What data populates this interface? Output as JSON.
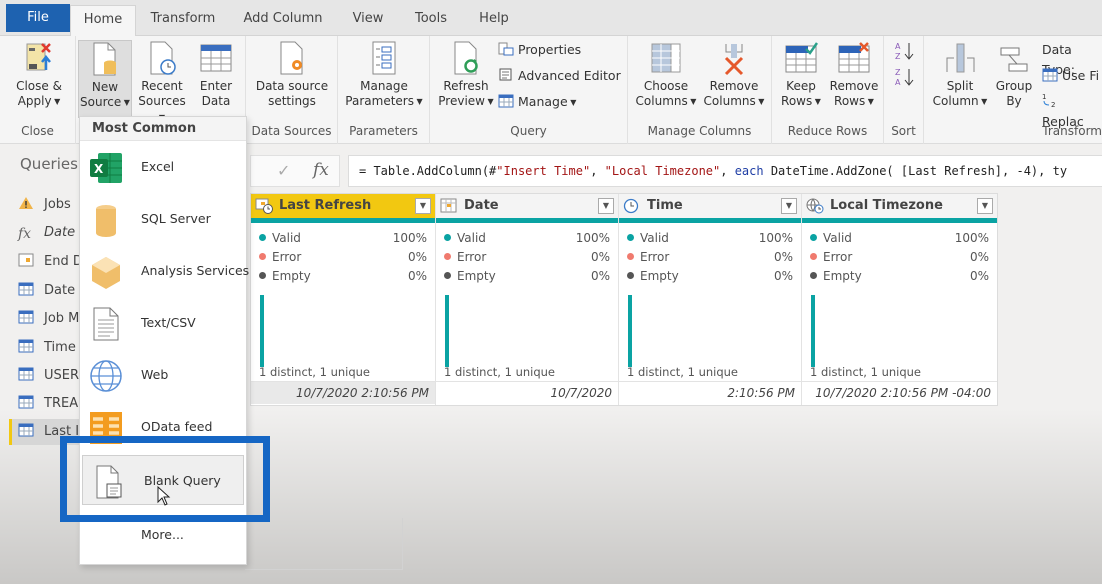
{
  "tabs": [
    {
      "label": "File"
    },
    {
      "label": "Home",
      "active": true
    },
    {
      "label": "Transform"
    },
    {
      "label": "Add Column"
    },
    {
      "label": "View"
    },
    {
      "label": "Tools"
    },
    {
      "label": "Help"
    }
  ],
  "ribbon": {
    "close_group": {
      "label": "Close",
      "close_apply": [
        "Close &",
        "Apply"
      ]
    },
    "new_query_group": {
      "new_source": [
        "New",
        "Source"
      ],
      "recent_sources": [
        "Recent",
        "Sources"
      ],
      "enter_data": [
        "Enter",
        "Data"
      ]
    },
    "data_sources_group": {
      "label": "Data Sources",
      "settings": [
        "Data source",
        "settings"
      ]
    },
    "parameters_group": {
      "label": "Parameters",
      "manage": [
        "Manage",
        "Parameters"
      ]
    },
    "query_group": {
      "label": "Query",
      "refresh": [
        "Refresh",
        "Preview"
      ],
      "properties": "Properties",
      "advanced_editor": "Advanced Editor",
      "manage": "Manage"
    },
    "manage_columns_group": {
      "label": "Manage Columns",
      "choose": [
        "Choose",
        "Columns"
      ],
      "remove": [
        "Remove",
        "Columns"
      ]
    },
    "reduce_rows_group": {
      "label": "Reduce Rows",
      "keep": [
        "Keep",
        "Rows"
      ],
      "remove": [
        "Remove",
        "Rows"
      ]
    },
    "sort_group": {
      "label": "Sort"
    },
    "transform_group": {
      "label": "Transform",
      "split": [
        "Split",
        "Column"
      ],
      "group_by": [
        "Group",
        "By"
      ],
      "data_type": "Data Type:",
      "use_first": "Use Fi",
      "replace": "Replac"
    }
  },
  "queries": {
    "title": "Queries",
    "items": [
      {
        "label": "Jobs",
        "icon": "warning-icon"
      },
      {
        "label": "Date",
        "icon": "function-icon",
        "italic": true
      },
      {
        "label": "End D",
        "icon": "table-icon"
      },
      {
        "label": "Date",
        "icon": "table-icon"
      },
      {
        "label": "Job M",
        "icon": "table-icon"
      },
      {
        "label": "Time",
        "icon": "table-icon"
      },
      {
        "label": "USER",
        "icon": "table-icon"
      },
      {
        "label": "TREA",
        "icon": "table-icon"
      },
      {
        "label": "Last I",
        "icon": "table-icon",
        "selected": true
      }
    ]
  },
  "formula": {
    "prefix": "= Table.AddColumn(#",
    "arg1": "\"Insert Time\"",
    "sep1": ", ",
    "arg2": "\"Local Timezone\"",
    "sep2": ", ",
    "kw": "each",
    "rest": " DateTime.AddZone( [Last Refresh], -4), ty"
  },
  "columns": [
    {
      "name": "Last Refresh",
      "icon": "datetime-icon",
      "selected": true,
      "valid": "100%",
      "error": "0%",
      "empty": "0%",
      "distinct": "1 distinct, 1 unique",
      "value": "10/7/2020 2:10:56 PM"
    },
    {
      "name": "Date",
      "icon": "calendar-icon",
      "valid": "100%",
      "error": "0%",
      "empty": "0%",
      "distinct": "1 distinct, 1 unique",
      "value": "10/7/2020"
    },
    {
      "name": "Time",
      "icon": "clock-icon",
      "valid": "100%",
      "error": "0%",
      "empty": "0%",
      "distinct": "1 distinct, 1 unique",
      "value": "2:10:56 PM"
    },
    {
      "name": "Local Timezone",
      "icon": "globe-clock-icon",
      "valid": "100%",
      "error": "0%",
      "empty": "0%",
      "distinct": "1 distinct, 1 unique",
      "value": "10/7/2020 2:10:56 PM -04:00"
    }
  ],
  "profile_labels": {
    "valid": "Valid",
    "error": "Error",
    "empty": "Empty"
  },
  "colors": {
    "valid": "#0aa3a3",
    "error": "#f07a6e",
    "empty": "#555555",
    "accent": "#f2c811",
    "highlight": "#1566c4"
  },
  "dropdown": {
    "title": "Most Common",
    "items": [
      {
        "label": "Excel",
        "icon": "excel-icon"
      },
      {
        "label": "SQL Server",
        "icon": "database-icon"
      },
      {
        "label": "Analysis Services",
        "icon": "cube-icon"
      },
      {
        "label": "Text/CSV",
        "icon": "text-file-icon"
      },
      {
        "label": "Web",
        "icon": "globe-icon"
      },
      {
        "label": "OData feed",
        "icon": "odata-icon"
      },
      {
        "label": "Blank Query",
        "icon": "blank-query-icon",
        "hover": true
      },
      {
        "label": "More..."
      }
    ]
  }
}
